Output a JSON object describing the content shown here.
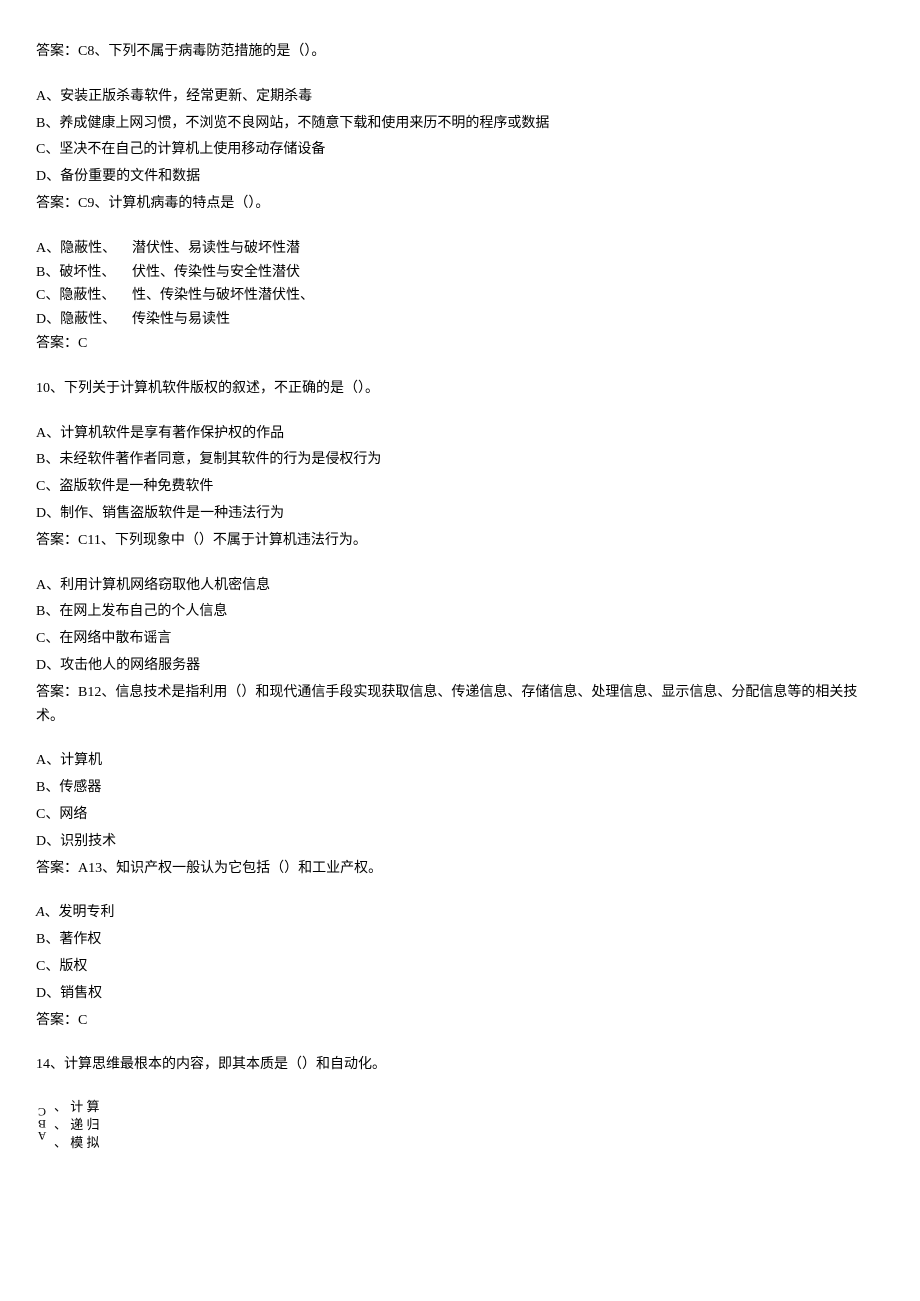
{
  "q8": {
    "answer_line": "答案：C8、下列不属于病毒防范措施的是（）。",
    "optA": "A、安装正版杀毒软件，经常更新、定期杀毒",
    "optB": "B、养成健康上网习惯，不浏览不良网站，不随意下载和使用来历不明的程序或数据",
    "optC": "C、坚决不在自己的计算机上使用移动存储设备",
    "optD": "D、备份重要的文件和数据"
  },
  "q9": {
    "answer_line": "答案：C9、计算机病毒的特点是（）。",
    "col1": {
      "a": "A、隐蔽性、",
      "b": "B、破坏性、",
      "c": "C、隐蔽性、",
      "d": "D、隐蔽性、"
    },
    "col2": {
      "a": "潜伏性、易读性与破坏性潜",
      "b": "伏性、传染性与安全性潜伏",
      "c": "性、传染性与破坏性潜伏性、",
      "d": "传染性与易读性"
    },
    "answer": "答案：C"
  },
  "q10": {
    "stem": "10、下列关于计算机软件版权的叙述，不正确的是（）。",
    "optA": "A、计算机软件是享有著作保护权的作品",
    "optB": "B、未经软件著作者同意，复制其软件的行为是侵权行为",
    "optC": "C、盗版软件是一种免费软件",
    "optD": "D、制作、销售盗版软件是一种违法行为"
  },
  "q11": {
    "answer_line": "答案：C11、下列现象中（）不属于计算机违法行为。",
    "optA": "A、利用计算机网络窃取他人机密信息",
    "optB": "B、在网上发布自己的个人信息",
    "optC": "C、在网络中散布谣言",
    "optD": "D、攻击他人的网络服务器"
  },
  "q12": {
    "answer_line": "答案：B12、信息技术是指利用（）和现代通信手段实现获取信息、传递信息、存储信息、处理信息、显示信息、分配信息等的相关技术。",
    "optA": "A、计算机",
    "optB": "B、传感器",
    "optC": "C、网络",
    "optD": "D、识别技术"
  },
  "q13": {
    "answer_line": "答案：A13、知识产权一般认为它包括（）和工业产权。",
    "optA_prefix": "A",
    "optA_suffix": "、发明专利",
    "optB": "B、著作权",
    "optC": "C、版权",
    "optD": "D、销售权",
    "answer": "答案：C"
  },
  "q14": {
    "stem": "14、计算思维最根本的内容，即其本质是（）和自动化。",
    "label_col": "ABC",
    "optA": "、 计 算",
    "optB": "、 递 归",
    "optC": "、 模 拟"
  }
}
